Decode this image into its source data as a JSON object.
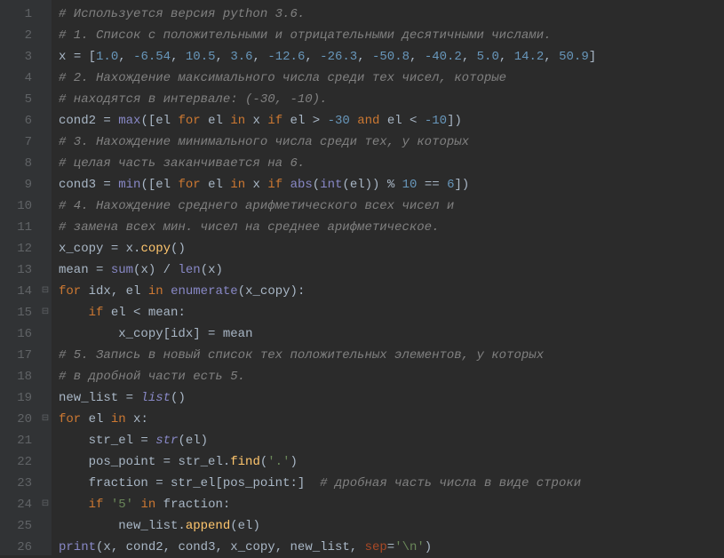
{
  "lines": [
    {
      "num": "1",
      "fold": "",
      "tokens": [
        [
          "c-comment",
          "# Используется версия python 3.6."
        ]
      ]
    },
    {
      "num": "2",
      "fold": "",
      "tokens": [
        [
          "c-comment",
          "# 1. Список с положительными и отрицательными десятичными числами."
        ]
      ]
    },
    {
      "num": "3",
      "fold": "",
      "tokens": [
        [
          "c-var",
          "x "
        ],
        [
          "c-assign",
          "= "
        ],
        [
          "c-bracket",
          "["
        ],
        [
          "c-num",
          "1.0"
        ],
        [
          "c-op",
          ", "
        ],
        [
          "c-num",
          "-6.54"
        ],
        [
          "c-op",
          ", "
        ],
        [
          "c-num",
          "10.5"
        ],
        [
          "c-op",
          ", "
        ],
        [
          "c-num",
          "3.6"
        ],
        [
          "c-op",
          ", "
        ],
        [
          "c-num",
          "-12.6"
        ],
        [
          "c-op",
          ", "
        ],
        [
          "c-num",
          "-26.3"
        ],
        [
          "c-op",
          ", "
        ],
        [
          "c-num",
          "-50.8"
        ],
        [
          "c-op",
          ", "
        ],
        [
          "c-num",
          "-40.2"
        ],
        [
          "c-op",
          ", "
        ],
        [
          "c-num",
          "5.0"
        ],
        [
          "c-op",
          ", "
        ],
        [
          "c-num",
          "14.2"
        ],
        [
          "c-op",
          ", "
        ],
        [
          "c-num",
          "50.9"
        ],
        [
          "c-bracket",
          "]"
        ]
      ]
    },
    {
      "num": "4",
      "fold": "",
      "tokens": [
        [
          "c-comment",
          "# 2. Нахождение максимального числа среди тех чисел, которые"
        ]
      ]
    },
    {
      "num": "5",
      "fold": "",
      "tokens": [
        [
          "c-comment",
          "# находятся в интервале: (-30, -10)."
        ]
      ]
    },
    {
      "num": "6",
      "fold": "",
      "tokens": [
        [
          "c-var",
          "cond2 "
        ],
        [
          "c-assign",
          "= "
        ],
        [
          "c-builtin",
          "max"
        ],
        [
          "c-bracket",
          "(["
        ],
        [
          "c-var",
          "el "
        ],
        [
          "c-kw",
          "for"
        ],
        [
          "c-var",
          " el "
        ],
        [
          "c-kw",
          "in"
        ],
        [
          "c-var",
          " x "
        ],
        [
          "c-kw",
          "if"
        ],
        [
          "c-var",
          " el "
        ],
        [
          "c-op",
          "> "
        ],
        [
          "c-num",
          "-30"
        ],
        [
          "c-var",
          " "
        ],
        [
          "c-kw",
          "and"
        ],
        [
          "c-var",
          " el "
        ],
        [
          "c-op",
          "< "
        ],
        [
          "c-num",
          "-10"
        ],
        [
          "c-bracket",
          "])"
        ]
      ]
    },
    {
      "num": "7",
      "fold": "",
      "tokens": [
        [
          "c-comment",
          "# 3. Нахождение минимального числа среди тех, у которых"
        ]
      ]
    },
    {
      "num": "8",
      "fold": "",
      "tokens": [
        [
          "c-comment",
          "# целая часть заканчивается на 6."
        ]
      ]
    },
    {
      "num": "9",
      "fold": "",
      "tokens": [
        [
          "c-var",
          "cond3 "
        ],
        [
          "c-assign",
          "= "
        ],
        [
          "c-builtin",
          "min"
        ],
        [
          "c-bracket",
          "(["
        ],
        [
          "c-var",
          "el "
        ],
        [
          "c-kw",
          "for"
        ],
        [
          "c-var",
          " el "
        ],
        [
          "c-kw",
          "in"
        ],
        [
          "c-var",
          " x "
        ],
        [
          "c-kw",
          "if"
        ],
        [
          "c-var",
          " "
        ],
        [
          "c-builtin",
          "abs"
        ],
        [
          "c-bracket",
          "("
        ],
        [
          "c-builtin",
          "int"
        ],
        [
          "c-bracket",
          "("
        ],
        [
          "c-var",
          "el"
        ],
        [
          "c-bracket",
          "))"
        ],
        [
          "c-op",
          " % "
        ],
        [
          "c-num",
          "10"
        ],
        [
          "c-op",
          " == "
        ],
        [
          "c-num",
          "6"
        ],
        [
          "c-bracket",
          "])"
        ]
      ]
    },
    {
      "num": "10",
      "fold": "",
      "tokens": [
        [
          "c-comment",
          "# 4. Нахождение среднего арифметического всех чисел и"
        ]
      ]
    },
    {
      "num": "11",
      "fold": "",
      "tokens": [
        [
          "c-comment",
          "# замена всех мин. чисел на среднее арифметическое."
        ]
      ]
    },
    {
      "num": "12",
      "fold": "",
      "tokens": [
        [
          "c-var",
          "x_copy "
        ],
        [
          "c-assign",
          "= "
        ],
        [
          "c-var",
          "x."
        ],
        [
          "c-func",
          "copy"
        ],
        [
          "c-bracket",
          "()"
        ]
      ]
    },
    {
      "num": "13",
      "fold": "",
      "tokens": [
        [
          "c-var",
          "mean "
        ],
        [
          "c-assign",
          "= "
        ],
        [
          "c-builtin",
          "sum"
        ],
        [
          "c-bracket",
          "("
        ],
        [
          "c-var",
          "x"
        ],
        [
          "c-bracket",
          ")"
        ],
        [
          "c-op",
          " / "
        ],
        [
          "c-builtin",
          "len"
        ],
        [
          "c-bracket",
          "("
        ],
        [
          "c-var",
          "x"
        ],
        [
          "c-bracket",
          ")"
        ]
      ]
    },
    {
      "num": "14",
      "fold": "⊟",
      "tokens": [
        [
          "c-kw",
          "for"
        ],
        [
          "c-var",
          " idx"
        ],
        [
          "c-op",
          ", "
        ],
        [
          "c-var",
          "el "
        ],
        [
          "c-kw",
          "in"
        ],
        [
          "c-var",
          " "
        ],
        [
          "c-builtin",
          "enumerate"
        ],
        [
          "c-bracket",
          "("
        ],
        [
          "c-var",
          "x_copy"
        ],
        [
          "c-bracket",
          ")"
        ],
        [
          "c-op",
          ":"
        ]
      ]
    },
    {
      "num": "15",
      "fold": "⊟",
      "tokens": [
        [
          "c-var",
          "    "
        ],
        [
          "c-kw",
          "if"
        ],
        [
          "c-var",
          " el "
        ],
        [
          "c-op",
          "< "
        ],
        [
          "c-var",
          "mean"
        ],
        [
          "c-op",
          ":"
        ]
      ]
    },
    {
      "num": "16",
      "fold": "",
      "tokens": [
        [
          "c-var",
          "        x_copy"
        ],
        [
          "c-bracket",
          "["
        ],
        [
          "c-var",
          "idx"
        ],
        [
          "c-bracket",
          "]"
        ],
        [
          "c-op",
          " = "
        ],
        [
          "c-var",
          "mean"
        ]
      ]
    },
    {
      "num": "17",
      "fold": "",
      "tokens": [
        [
          "c-comment",
          "# 5. Запись в новый список тех положительных элементов, у которых"
        ]
      ]
    },
    {
      "num": "18",
      "fold": "",
      "tokens": [
        [
          "c-comment",
          "# в дробной части есть 5."
        ]
      ]
    },
    {
      "num": "19",
      "fold": "",
      "tokens": [
        [
          "c-var",
          "new_list "
        ],
        [
          "c-assign",
          "= "
        ],
        [
          "c-builtin2",
          "list"
        ],
        [
          "c-bracket",
          "()"
        ]
      ]
    },
    {
      "num": "20",
      "fold": "⊟",
      "tokens": [
        [
          "c-kw",
          "for"
        ],
        [
          "c-var",
          " el "
        ],
        [
          "c-kw",
          "in"
        ],
        [
          "c-var",
          " x"
        ],
        [
          "c-op",
          ":"
        ]
      ]
    },
    {
      "num": "21",
      "fold": "",
      "tokens": [
        [
          "c-var",
          "    str_el "
        ],
        [
          "c-assign",
          "= "
        ],
        [
          "c-builtin2",
          "str"
        ],
        [
          "c-bracket",
          "("
        ],
        [
          "c-var",
          "el"
        ],
        [
          "c-bracket",
          ")"
        ]
      ]
    },
    {
      "num": "22",
      "fold": "",
      "tokens": [
        [
          "c-var",
          "    pos_point "
        ],
        [
          "c-assign",
          "= "
        ],
        [
          "c-var",
          "str_el."
        ],
        [
          "c-func",
          "find"
        ],
        [
          "c-bracket",
          "("
        ],
        [
          "c-str",
          "'.'"
        ],
        [
          "c-bracket",
          ")"
        ]
      ]
    },
    {
      "num": "23",
      "fold": "",
      "tokens": [
        [
          "c-var",
          "    fraction "
        ],
        [
          "c-assign",
          "= "
        ],
        [
          "c-var",
          "str_el"
        ],
        [
          "c-bracket",
          "["
        ],
        [
          "c-var",
          "pos_point"
        ],
        [
          "c-op",
          ":"
        ],
        [
          "c-bracket",
          "]"
        ],
        [
          "c-var",
          "  "
        ],
        [
          "c-comment",
          "# дробная часть числа в виде строки"
        ]
      ]
    },
    {
      "num": "24",
      "fold": "⊟",
      "tokens": [
        [
          "c-var",
          "    "
        ],
        [
          "c-kw",
          "if"
        ],
        [
          "c-var",
          " "
        ],
        [
          "c-str",
          "'5'"
        ],
        [
          "c-var",
          " "
        ],
        [
          "c-kw",
          "in"
        ],
        [
          "c-var",
          " fraction"
        ],
        [
          "c-op",
          ":"
        ]
      ]
    },
    {
      "num": "25",
      "fold": "",
      "tokens": [
        [
          "c-var",
          "        new_list."
        ],
        [
          "c-func",
          "append"
        ],
        [
          "c-bracket",
          "("
        ],
        [
          "c-var",
          "el"
        ],
        [
          "c-bracket",
          ")"
        ]
      ]
    },
    {
      "num": "26",
      "fold": "",
      "tokens": [
        [
          "c-builtin",
          "print"
        ],
        [
          "c-bracket",
          "("
        ],
        [
          "c-var",
          "x"
        ],
        [
          "c-op",
          ", "
        ],
        [
          "c-var",
          "cond2"
        ],
        [
          "c-op",
          ", "
        ],
        [
          "c-var",
          "cond3"
        ],
        [
          "c-op",
          ", "
        ],
        [
          "c-var",
          "x_copy"
        ],
        [
          "c-op",
          ", "
        ],
        [
          "c-var",
          "new_list"
        ],
        [
          "c-op",
          ", "
        ],
        [
          "c-param",
          "sep"
        ],
        [
          "c-op",
          "="
        ],
        [
          "c-str",
          "'\\n'"
        ],
        [
          "c-bracket",
          ")"
        ]
      ]
    }
  ]
}
